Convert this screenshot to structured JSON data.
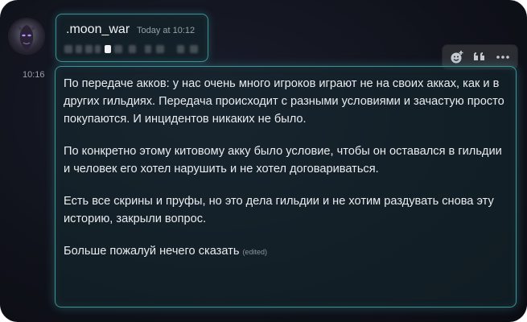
{
  "author": {
    "name": ".moon_war",
    "timestamp": "Today at 10:12"
  },
  "message": {
    "side_time": "10:16",
    "paragraphs": [
      "По передаче акков: у нас очень много игроков играют не на своих акках, как и в других гильдиях. Передача происходит с разными условиями и зачастую просто покупаются. И инцидентов никаких не было.",
      "По конкретно этому китовому акку было условие, чтобы он оставался в гильдии и человек его хотел нарушить и не хотел договариваться.",
      "Есть все скрины и пруфы, но это дела гильдии и не хотим раздувать снова эту историю, закрыли вопрос.",
      "Больше пожалуй нечего сказать"
    ],
    "edited_label": "(edited)"
  },
  "toolbar": {
    "buttons": [
      {
        "icon": "add-reaction-icon"
      },
      {
        "icon": "quote-icon"
      },
      {
        "icon": "more-icon"
      }
    ]
  },
  "colors": {
    "glow": "#3b9297",
    "background": "#10121b",
    "text": "#e9ecef"
  }
}
